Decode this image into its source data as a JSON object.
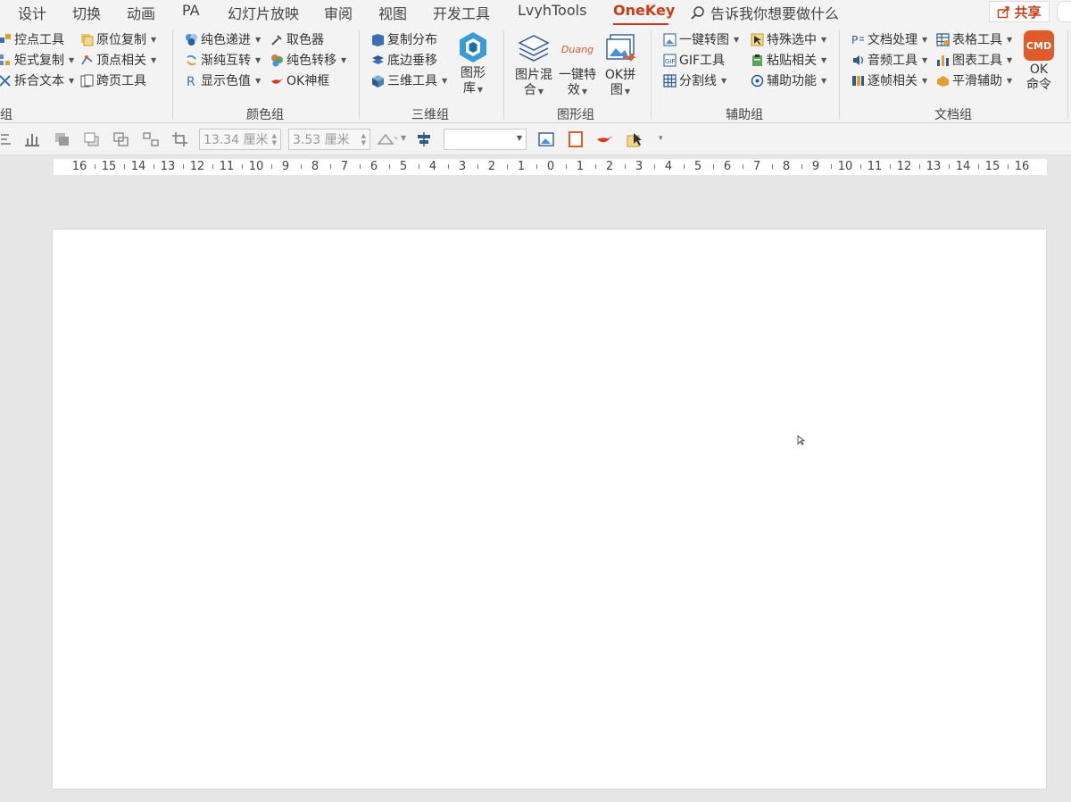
{
  "tabs": [
    {
      "label": "设计",
      "active": false
    },
    {
      "label": "切换",
      "active": false
    },
    {
      "label": "动画",
      "active": false
    },
    {
      "label": "PA",
      "active": false
    },
    {
      "label": "幻灯片放映",
      "active": false
    },
    {
      "label": "审阅",
      "active": false
    },
    {
      "label": "视图",
      "active": false
    },
    {
      "label": "开发工具",
      "active": false
    },
    {
      "label": "LvyhTools",
      "active": false
    },
    {
      "label": "OneKey",
      "active": true
    }
  ],
  "search": {
    "text": "告诉我你想要做什么"
  },
  "share": {
    "label": "共享"
  },
  "groups": {
    "g0": {
      "label": "组",
      "items": [
        "控点工具",
        "矩式复制",
        "拆合文本",
        "原位复制",
        "顶点相关",
        "跨页工具"
      ]
    },
    "color": {
      "label": "颜色组",
      "items": [
        "纯色递进",
        "渐纯互转",
        "显示色值",
        "取色器",
        "纯色转移",
        "OK神框"
      ]
    },
    "threed": {
      "label": "三维组",
      "items": [
        "复制分布",
        "底边垂移",
        "三维工具"
      ],
      "big": {
        "l1": "图形",
        "l2": "库"
      }
    },
    "shape": {
      "label": "图形组",
      "big": [
        {
          "l1": "图片混",
          "l2": "合"
        },
        {
          "l1": "一键特",
          "l2": "效"
        },
        {
          "l1": "OK拼",
          "l2": "图"
        }
      ],
      "duang": "Duang"
    },
    "aux": {
      "label": "辅助组",
      "items": [
        "一键转图",
        "GIF工具",
        "分割线",
        "特殊选中",
        "粘贴相关",
        "辅助功能"
      ]
    },
    "doc": {
      "label": "文档组",
      "items": [
        "文档处理",
        "音频工具",
        "逐帧相关",
        "表格工具",
        "图表工具",
        "平滑辅助"
      ],
      "cmd": {
        "icon": "CMD",
        "l1": "OK",
        "l2": "命令"
      }
    }
  },
  "toolbar": {
    "width": "13.34 厘米",
    "height": "3.53 厘米"
  },
  "ruler": {
    "labels": [
      "16",
      "15",
      "14",
      "13",
      "12",
      "11",
      "10",
      "9",
      "8",
      "7",
      "6",
      "5",
      "4",
      "3",
      "2",
      "1",
      "0",
      "1",
      "2",
      "3",
      "4",
      "5",
      "6",
      "7",
      "8",
      "9",
      "10",
      "11",
      "12",
      "13",
      "14",
      "15",
      "16"
    ]
  },
  "colors": {
    "accent": "#c43e1c",
    "ribbon_bg": "#f3f3f3",
    "workspace": "#e6e6e6",
    "slide": "#ffffff"
  }
}
